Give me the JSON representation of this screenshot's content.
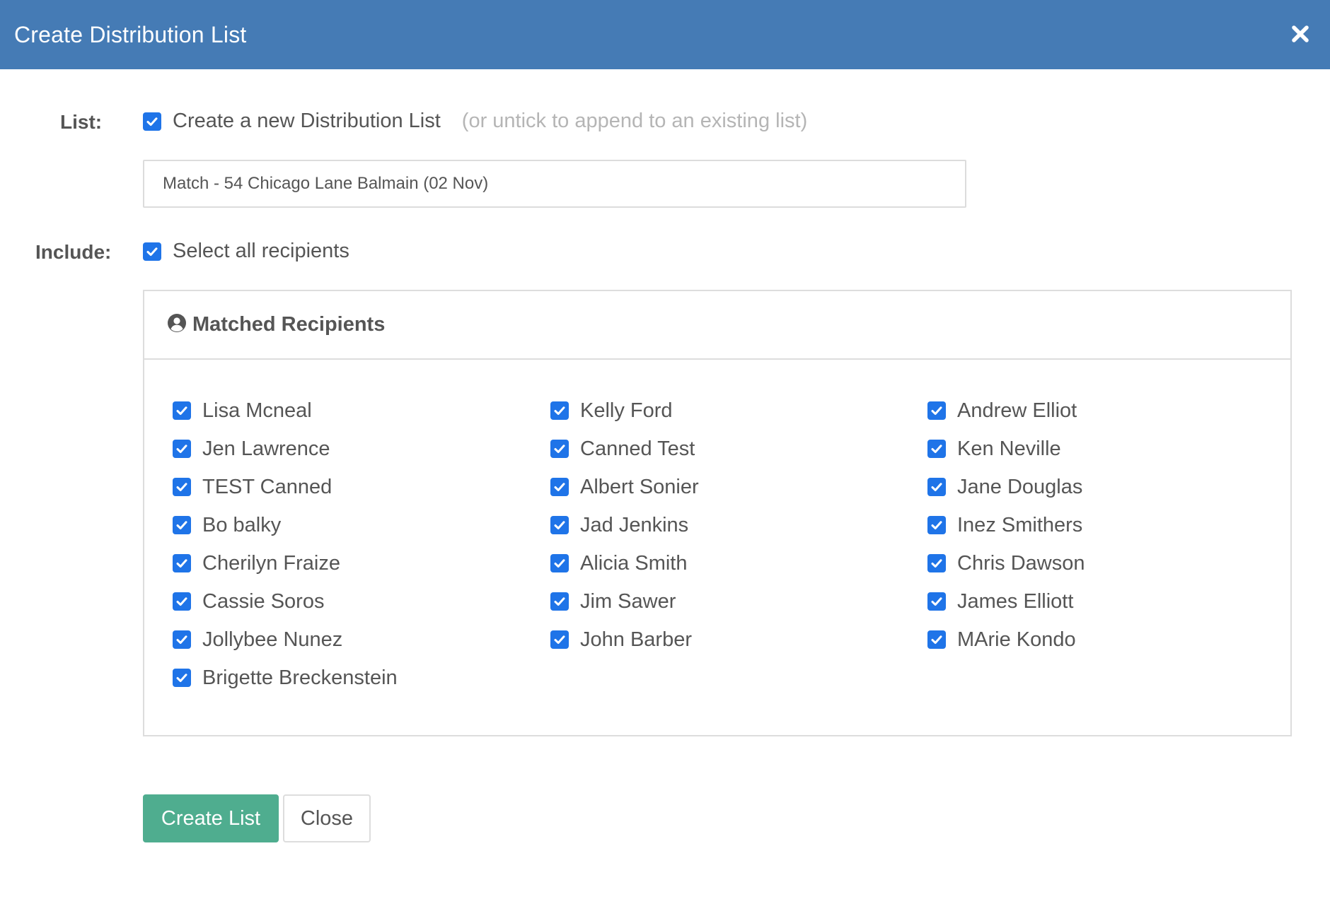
{
  "modal": {
    "title": "Create Distribution List",
    "close_icon": "close-icon"
  },
  "list_row": {
    "label": "List:",
    "checkbox_label": "Create a new Distribution List",
    "checked": true,
    "hint": "(or untick to append to an existing list)",
    "name_value": "Match - 54 Chicago Lane Balmain (02 Nov)"
  },
  "include_row": {
    "label": "Include:",
    "checkbox_label": "Select all recipients",
    "checked": true
  },
  "panel": {
    "icon": "user-circle-icon",
    "title": "Matched Recipients"
  },
  "recipients": {
    "col1": [
      "Lisa Mcneal",
      "Jen Lawrence",
      "TEST Canned",
      "Bo balky",
      "Cherilyn Fraize",
      "Cassie Soros",
      "Jollybee Nunez",
      "Brigette Breckenstein"
    ],
    "col2": [
      "Kelly Ford",
      "Canned Test",
      "Albert Sonier",
      "Jad Jenkins",
      "Alicia Smith",
      "Jim Sawer",
      "John Barber"
    ],
    "col3": [
      "Andrew Elliot",
      "Ken Neville",
      "Jane Douglas",
      "Inez Smithers",
      "Chris Dawson",
      "James Elliott",
      "MArie Kondo"
    ]
  },
  "buttons": {
    "create_label": "Create List",
    "close_label": "Close"
  },
  "colors": {
    "header": "#457bb5",
    "checkbox": "#1f74e8",
    "primary_button": "#4fad8f"
  }
}
